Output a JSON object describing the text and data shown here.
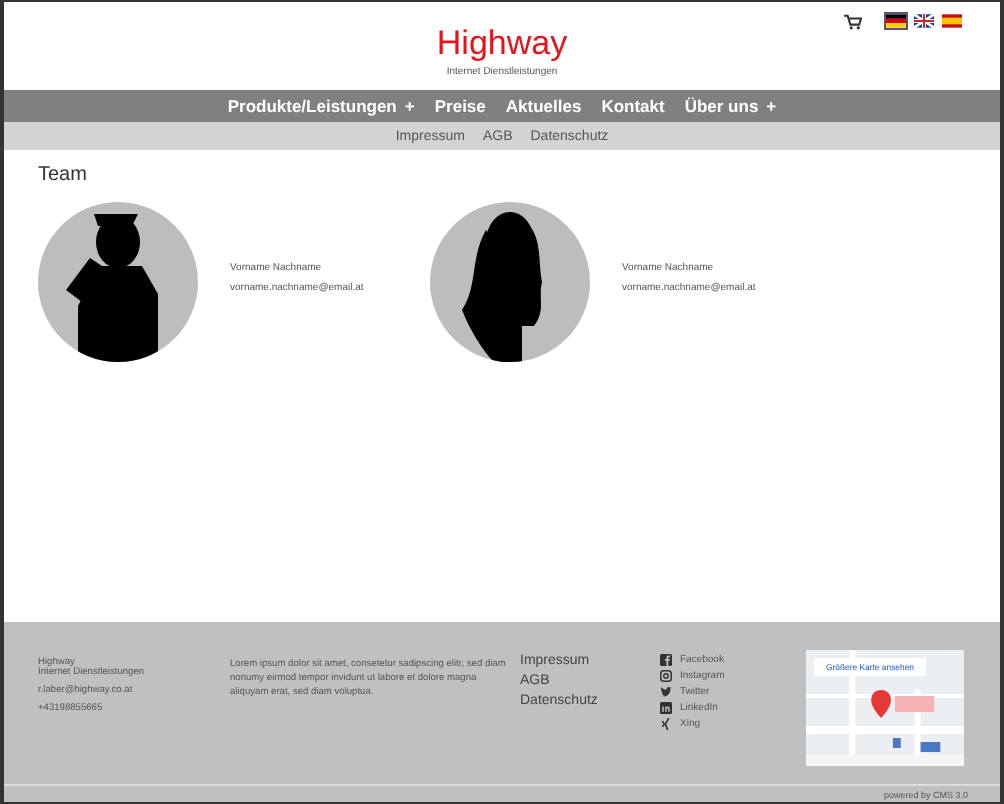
{
  "header": {
    "logo": "Highway",
    "tagline": "Internet Dienstleistungen",
    "languages": [
      {
        "kind": "german",
        "selected": true
      },
      {
        "kind": "british",
        "selected": false
      },
      {
        "kind": "spanish",
        "selected": false
      }
    ]
  },
  "nav": [
    {
      "label": "Produkte/Leistungen",
      "submenu": true
    },
    {
      "label": "Preise",
      "submenu": false
    },
    {
      "label": "Aktuelles",
      "submenu": false
    },
    {
      "label": "Kontakt",
      "submenu": false
    },
    {
      "label": "Über uns",
      "submenu": true
    }
  ],
  "nav_plus": "+",
  "subnav": [
    "Impressum",
    "AGB",
    "Datenschutz"
  ],
  "team": {
    "title": "Team",
    "members": [
      {
        "name": "Vorname Nachname",
        "email": "vorname.nachname@email.at",
        "kind": "man"
      },
      {
        "name": "Vorname Nachname",
        "email": "vorname.nachname@email.at",
        "kind": "woman"
      }
    ]
  },
  "footer": {
    "company": [
      "Highway",
      "Internet Dienstleistungen"
    ],
    "email": "r.laber@highway.co.at",
    "phone": "+43198855665",
    "text": "Lorem ipsum dolor sit amet, consetetur sadipscing elitr, sed diam nonumy eirmod tempor invidunt ut labore et dolore magna aliquyam erat, sed diam voluptua.",
    "links": [
      "Impressum",
      "AGB",
      "Datenschutz"
    ],
    "social": [
      {
        "kind": "facebook",
        "label": "Facebook"
      },
      {
        "kind": "instagram",
        "label": "Instagram"
      },
      {
        "kind": "twitter",
        "label": "Twitter"
      },
      {
        "kind": "linkedin",
        "label": "LinkedIn"
      },
      {
        "kind": "xing",
        "label": "Xing"
      }
    ],
    "map": {
      "link": "Größere Karte ansehen"
    },
    "powered": "powered by CMS 3.0"
  }
}
